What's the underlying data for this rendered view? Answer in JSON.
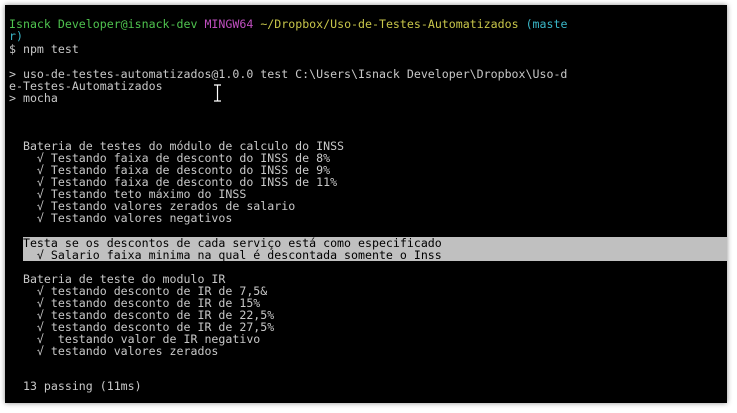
{
  "colors": {
    "background": "#000000",
    "text": "#c8c8c8",
    "user": "#4fc34f",
    "mingw": "#c04fc0",
    "path": "#c8c64a",
    "branch": "#3ab7c8",
    "selection_bg": "#c0c0c0",
    "selection_text": "#000000"
  },
  "prompt": {
    "user_host": "Isnack Developer@isnack-dev",
    "system": "MINGW64",
    "path": "~/Dropbox/Uso-de-Testes-Automatizados",
    "branch_part1": "(maste",
    "branch_part2": "r)"
  },
  "command": "$ npm test",
  "npm_output": {
    "line1": "> uso-de-testes-automatizados@1.0.0 test C:\\Users\\Isnack Developer\\Dropbox\\Uso-d",
    "line2": "e-Testes-Automatizados",
    "line3": "> mocha"
  },
  "suites": [
    {
      "title": "  Bateria de testes do módulo de calculo do INSS",
      "tests": [
        "    √ Testando faixa de desconto do INSS de 8%",
        "    √ Testando faixa de desconto do INSS de 9%",
        "    √ Testando faixa de desconto do INSS de 11%",
        "    √ Testando teto máximo do INSS",
        "    √ Testando valores zerados de salario",
        "    √ Testando valores negativos"
      ]
    },
    {
      "title": "  Testa se os descontos de cada serviço está como especificado",
      "tests": [
        "    √ Salario faixa minima na qual é descontada somente o Inss"
      ]
    },
    {
      "title": "  Bateria de teste do modulo IR",
      "tests": [
        "    √ testando desconto de IR de 7,5&",
        "    √ testando desconto de IR de 15%",
        "    √ testando desconto de IR de 22,5%",
        "    √ testando desconto de IR de 27,5%",
        "    √  testando valor de IR negativo",
        "    √ testando valores zerados"
      ]
    }
  ],
  "summary": "  13 passing (11ms)"
}
